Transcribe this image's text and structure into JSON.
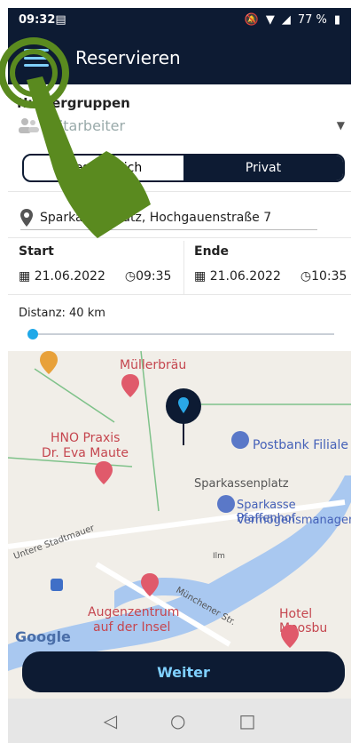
{
  "status": {
    "time": "09:32",
    "battery": "77 %"
  },
  "appbar": {
    "title": "Reservieren"
  },
  "group": {
    "label": "Nutzergruppen",
    "select_value": "Mitarbeiter"
  },
  "toggle": {
    "left": "Geschäftlich",
    "right": "Privat"
  },
  "address": {
    "value": "Sparkassenplatz, Hochgauenstraße 7"
  },
  "start": {
    "label": "Start",
    "date": "21.06.2022",
    "time": "09:35"
  },
  "ende": {
    "label": "Ende",
    "date": "21.06.2022",
    "time": "10:35"
  },
  "distance": {
    "label": "Distanz: 40 km",
    "value_fraction": 0.0
  },
  "map_labels": {
    "mullerbrau": "Müllerbräu",
    "hno1": "HNO Praxis",
    "hno2": "Dr. Eva Maute",
    "postbank": "Postbank Filiale",
    "sparkassenplatz": "Sparkassenplatz",
    "sparkasse1": "Sparkasse Pfaffenhof",
    "sparkasse2": "Vermögensmanagem",
    "untere": "Untere Stadtmauer",
    "augen1": "Augenzentrum",
    "augen2": "auf der Insel",
    "munchener": "Münchener Str.",
    "hotel": "Hotel Moosbu",
    "google": "Google",
    "ilm": "Ilm"
  },
  "button": {
    "weiter": "Weiter"
  },
  "nav": {
    "back": "◁",
    "home": "○",
    "recent": "□"
  },
  "colors": {
    "primary": "#0d1b33",
    "accent": "#1fa8e8",
    "hand": "#5a8a1f"
  }
}
